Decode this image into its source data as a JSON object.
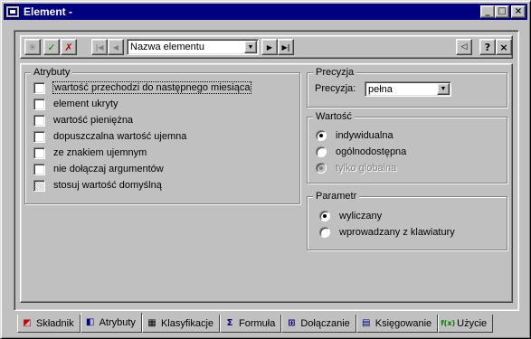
{
  "window": {
    "title": "Element -",
    "buttons": {
      "minimize": "_",
      "maximize": "□",
      "close": "×"
    }
  },
  "toolbar": {
    "asterisk_icon": "✳",
    "accept_icon": "✓",
    "cancel_icon": "✗",
    "first_icon": "|◀",
    "prev_icon": "◀",
    "combo_value": "Nazwa elementu",
    "next_icon": "▶",
    "last_icon": "▶|",
    "left_icon": "◁",
    "help_label": "?",
    "close_label": "×"
  },
  "attributes": {
    "legend": "Atrybuty",
    "items": [
      {
        "label": "wartość przechodzi do następnego miesiąca",
        "checked": false,
        "focused": true
      },
      {
        "label": "element ukryty",
        "checked": false
      },
      {
        "label": "wartość pieniężna",
        "checked": false
      },
      {
        "label": "dopuszczalna wartość ujemna",
        "checked": false
      },
      {
        "label": "ze znakiem ujemnym",
        "checked": false
      },
      {
        "label": "nie dołączaj argumentów",
        "checked": false
      },
      {
        "label": "stosuj wartość domyślną",
        "checked": false,
        "indeterminate": true
      }
    ]
  },
  "precision": {
    "legend": "Precyzja",
    "label": "Precyzja:",
    "value": "pełna"
  },
  "value_group": {
    "legend": "Wartość",
    "options": [
      {
        "label": "indywidualna",
        "selected": true
      },
      {
        "label": "ogólnodostępna",
        "selected": false
      },
      {
        "label": "tylko globalna",
        "selected": true,
        "disabled": true
      }
    ]
  },
  "parameter": {
    "legend": "Parametr",
    "options": [
      {
        "label": "wyliczany",
        "selected": true
      },
      {
        "label": "wprowadzany z klawiatury",
        "selected": false
      }
    ]
  },
  "tabs": [
    {
      "label": "Składnik",
      "icon": "component-icon",
      "glyph": "◩",
      "color": "#c00000"
    },
    {
      "label": "Atrybuty",
      "icon": "attributes-icon",
      "glyph": "◧",
      "color": "#000080",
      "active": true
    },
    {
      "label": "Klasyfikacje",
      "icon": "classification-icon",
      "glyph": "▦",
      "color": "#000000"
    },
    {
      "label": "Formuła",
      "icon": "formula-icon",
      "glyph": "Σ",
      "color": "#000080"
    },
    {
      "label": "Dołączanie",
      "icon": "attach-icon",
      "glyph": "⊞",
      "color": "#000080"
    },
    {
      "label": "Księgowanie",
      "icon": "accounting-icon",
      "glyph": "▤",
      "color": "#000080"
    },
    {
      "label": "Użycie",
      "icon": "usage-icon",
      "glyph": "f(x)",
      "color": "#008000"
    }
  ]
}
